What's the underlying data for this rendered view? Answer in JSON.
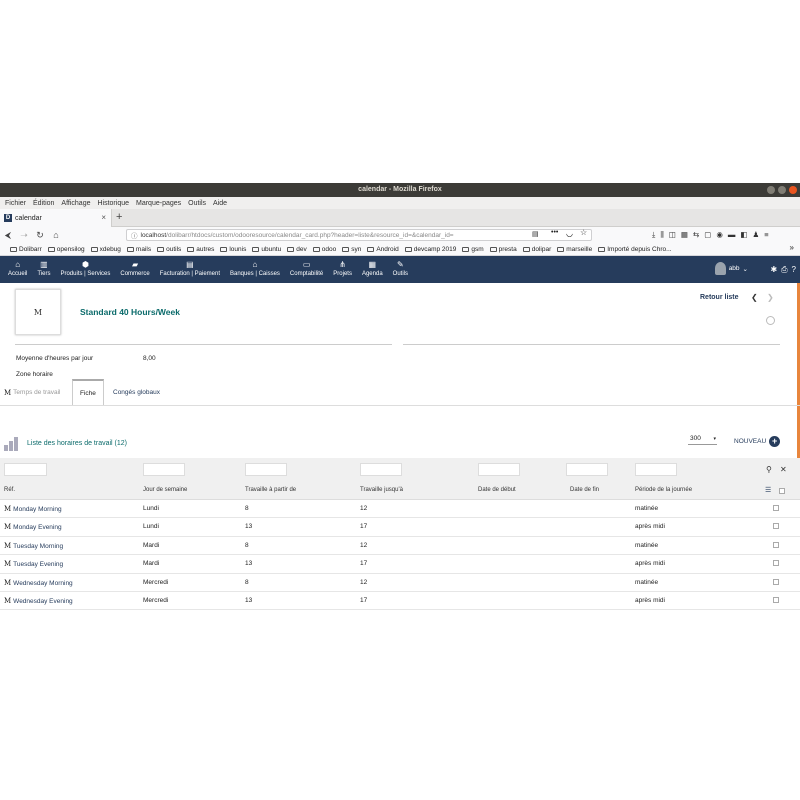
{
  "window": {
    "title": "calendar - Mozilla Firefox"
  },
  "menubar": [
    "Fichier",
    "Édition",
    "Affichage",
    "Historique",
    "Marque-pages",
    "Outils",
    "Aide"
  ],
  "browser_tab": {
    "title": "calendar",
    "close": "×",
    "new": "+"
  },
  "url": {
    "host": "localhost",
    "path": "/dolibarr/htdocs/custom/odooresource/calendar_card.php?header=liste&resource_id=&calendar_id="
  },
  "bookmarks": [
    "Dolibarr",
    "opensilog",
    "xdebug",
    "mails",
    "outils",
    "autres",
    "lounis",
    "ubuntu",
    "dev",
    "odoo",
    "syn",
    "Android",
    "devcamp 2019",
    "gsm",
    "presta",
    "dolipar",
    "marseille",
    "Importé depuis Chro..."
  ],
  "topmenu": [
    {
      "label": "Accueil",
      "icon": "home-icon"
    },
    {
      "label": "Tiers",
      "icon": "building-icon"
    },
    {
      "label": "Produits | Services",
      "icon": "cube-icon"
    },
    {
      "label": "Commerce",
      "icon": "briefcase-icon"
    },
    {
      "label": "Facturation | Paiement",
      "icon": "money-icon"
    },
    {
      "label": "Banques | Caisses",
      "icon": "bank-icon"
    },
    {
      "label": "Comptabilité",
      "icon": "card-icon"
    },
    {
      "label": "Projets",
      "icon": "sitemap-icon"
    },
    {
      "label": "Agenda",
      "icon": "calendar-icon"
    },
    {
      "label": "Outils",
      "icon": "wrench-icon"
    }
  ],
  "user": {
    "name": "abb"
  },
  "card": {
    "photo_letter": "M",
    "title": "Standard 40 Hours/Week",
    "back_label": "Retour liste",
    "fields": {
      "avg_label": "Moyenne d'heures par jour",
      "avg_value": "8,00",
      "tz_label": "Zone horaire"
    }
  },
  "tabs": {
    "work_time": "Temps de travail",
    "fiche": "Fiche",
    "conges": "Congés globaux"
  },
  "list": {
    "title": "Liste des horaires de travail (12)",
    "limit": "300",
    "new_label": "NOUVEAU",
    "columns": [
      "Réf.",
      "Jour de semaine",
      "Travaille à partir de",
      "Travaille jusqu'à",
      "Date de début",
      "Date de fin",
      "Période de la journée"
    ],
    "rows": [
      {
        "ref": "Monday Morning",
        "day": "Lundi",
        "from": "8",
        "to": "12",
        "start": "",
        "end": "",
        "period": "matinée"
      },
      {
        "ref": "Monday Evening",
        "day": "Lundi",
        "from": "13",
        "to": "17",
        "start": "",
        "end": "",
        "period": "après midi"
      },
      {
        "ref": "Tuesday Morning",
        "day": "Mardi",
        "from": "8",
        "to": "12",
        "start": "",
        "end": "",
        "period": "matinée"
      },
      {
        "ref": "Tuesday Evening",
        "day": "Mardi",
        "from": "13",
        "to": "17",
        "start": "",
        "end": "",
        "period": "après midi"
      },
      {
        "ref": "Wednesday Morning",
        "day": "Mercredi",
        "from": "8",
        "to": "12",
        "start": "",
        "end": "",
        "period": "matinée"
      },
      {
        "ref": "Wednesday Evening",
        "day": "Mercredi",
        "from": "13",
        "to": "17",
        "start": "",
        "end": "",
        "period": "après midi"
      }
    ]
  },
  "colors": {
    "dolibarr_nav": "#263c5c",
    "title_teal": "#0b6b6b",
    "accent_orange": "#e8853c"
  }
}
